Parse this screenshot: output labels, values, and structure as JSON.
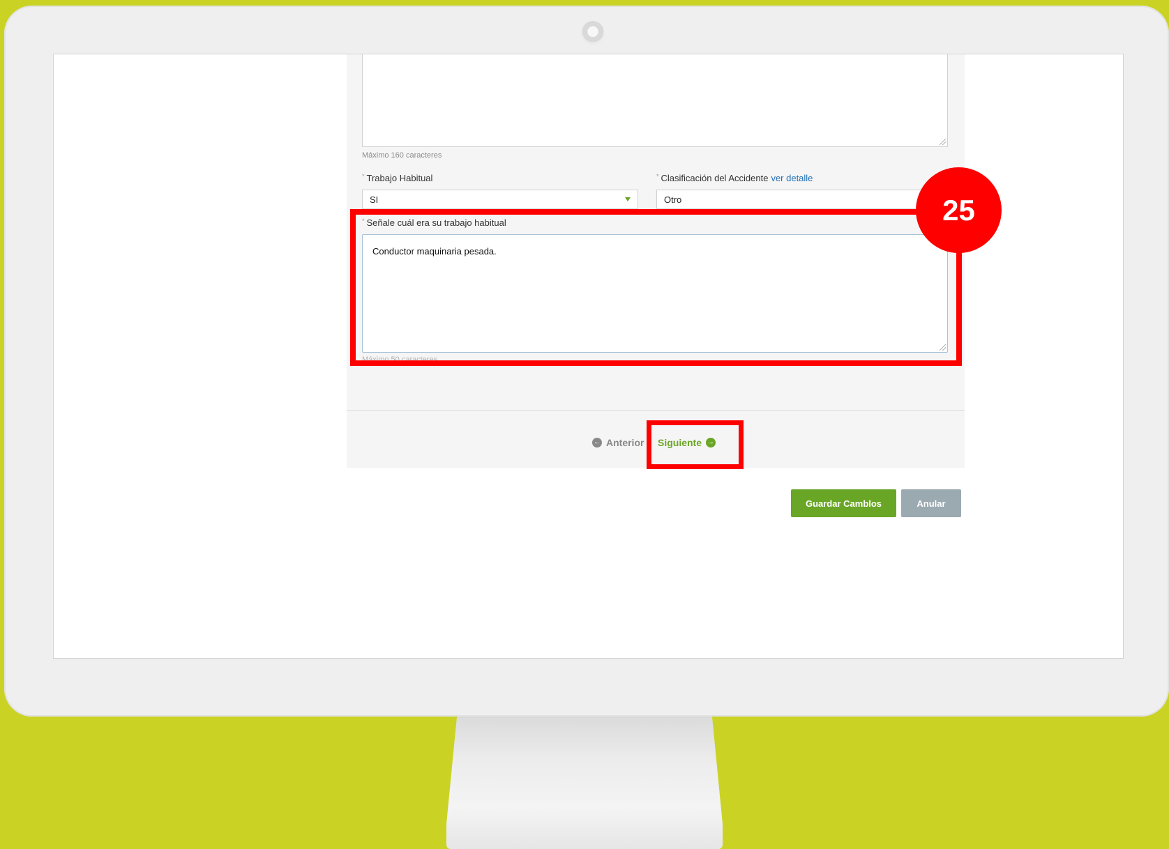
{
  "form": {
    "top_textarea_help": "Máximo 160 caracteres",
    "trabajo_habitual": {
      "required_mark": "*",
      "label": "Trabajo Habitual",
      "value": "SI"
    },
    "clasificacion": {
      "required_mark": "*",
      "label": "Clasificación del Accidente",
      "link": "ver detalle",
      "value": "Otro"
    },
    "senale_trabajo": {
      "required_mark": "*",
      "label": "Señale cuál era su trabajo habitual",
      "value": "Conductor maquinaria pesada.",
      "help": "Máximo 50 caracteres"
    }
  },
  "nav": {
    "prev_label": "Anterior",
    "next_label": "Siguiente"
  },
  "actions": {
    "save_label": "Guardar Camblos",
    "cancel_label": "Anular"
  },
  "annotation": {
    "step_number": "25"
  },
  "colors": {
    "background": "#cad324",
    "accent_green": "#6aa626",
    "highlight_red": "#ff0000",
    "link_blue": "#1f6fb5"
  }
}
